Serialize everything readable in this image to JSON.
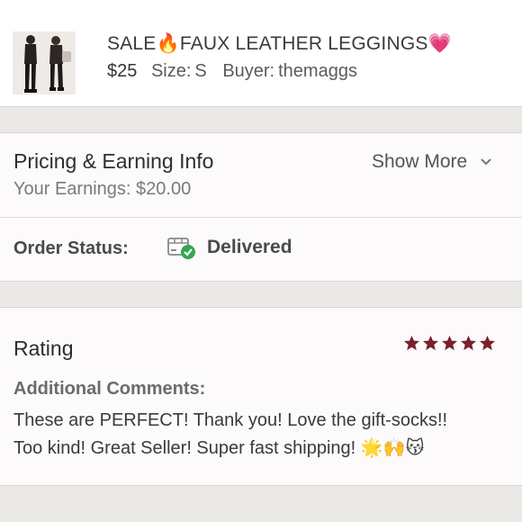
{
  "listing": {
    "title": "SALE🔥FAUX LEATHER LEGGINGS💗",
    "price": "$25",
    "size_label": "Size:",
    "size_value": "S",
    "buyer_label": "Buyer:",
    "buyer_value": "themaggs",
    "thumbnail_icon": "product-photo-leggings"
  },
  "pricing": {
    "title": "Pricing & Earning Info",
    "show_more": "Show More",
    "earnings": "Your Earnings: $20.00"
  },
  "status": {
    "label": "Order Status:",
    "value": "Delivered",
    "icon": "package-check-icon",
    "check_color": "#2fa84f"
  },
  "rating": {
    "title": "Rating",
    "stars": 5,
    "star_color": "#7a1f2b",
    "comments_label": "Additional Comments:",
    "comments_line1": "These are PERFECT! Thank you! Love the gift-socks!!",
    "comments_line2": "Too kind! Great Seller! Super fast shipping! 🌟🙌😽"
  }
}
